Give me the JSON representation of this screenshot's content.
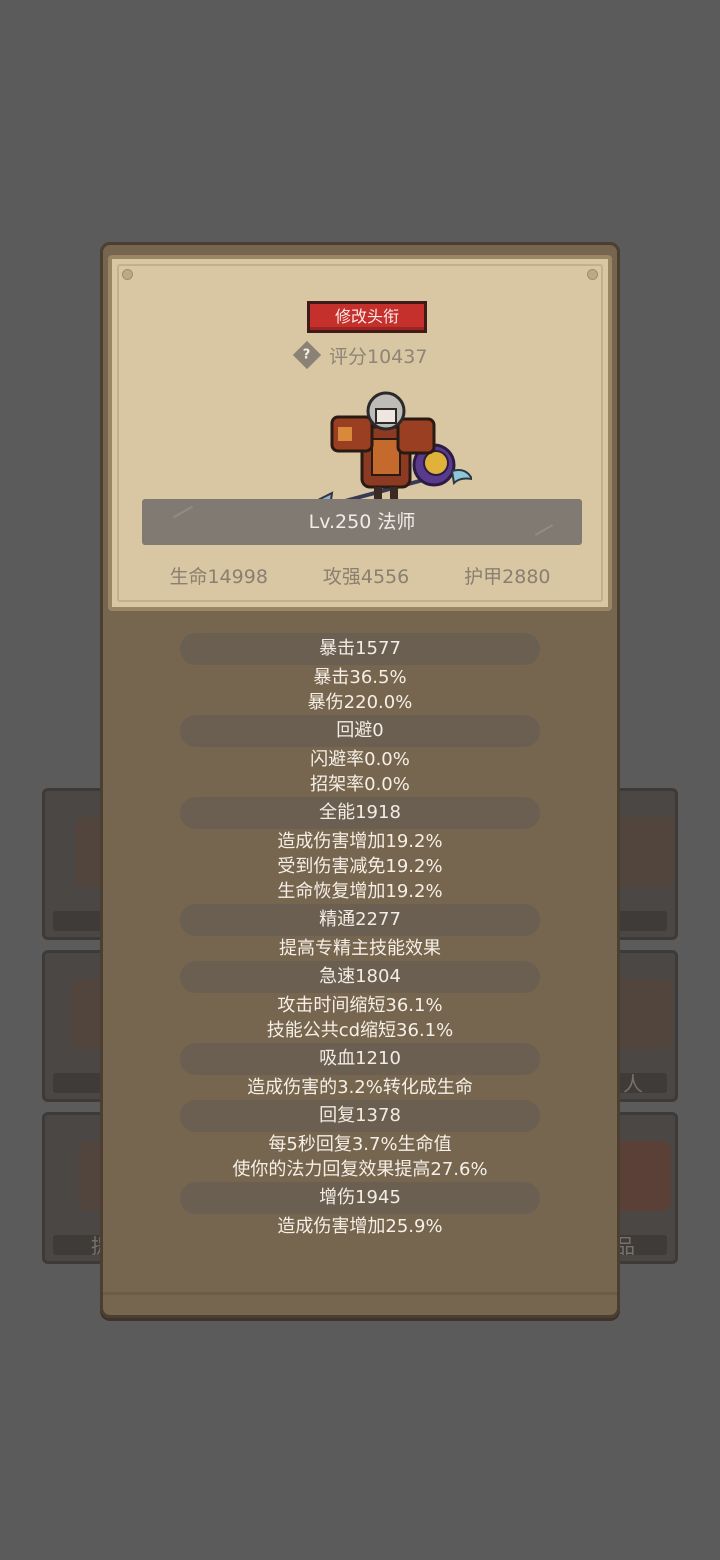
{
  "background_cards": {
    "ghost_labels": [
      "人",
      "提",
      "品"
    ]
  },
  "profile": {
    "change_title_button": "修改头衔",
    "help_icon_glyph": "?",
    "score": "评分10437",
    "level_class": "Lv.250 法师",
    "hp": "生命14998",
    "attack": "攻强4556",
    "armor": "护甲2880"
  },
  "stat_groups": [
    {
      "title": "暴击1577",
      "lines": [
        "暴击36.5%",
        "暴伤220.0%"
      ]
    },
    {
      "title": "回避0",
      "lines": [
        "闪避率0.0%",
        "招架率0.0%"
      ]
    },
    {
      "title": "全能1918",
      "lines": [
        "造成伤害增加19.2%",
        "受到伤害减免19.2%",
        "生命恢复增加19.2%"
      ]
    },
    {
      "title": "精通2277",
      "lines": [
        "提高专精主技能效果"
      ]
    },
    {
      "title": "急速1804",
      "lines": [
        "攻击时间缩短36.1%",
        "技能公共cd缩短36.1%"
      ]
    },
    {
      "title": "吸血1210",
      "lines": [
        "造成伤害的3.2%转化成生命"
      ]
    },
    {
      "title": "回复1378",
      "lines": [
        "每5秒回复3.7%生命值",
        "使你的法力回复效果提高27.6%"
      ]
    },
    {
      "title": "增伤1945",
      "lines": [
        "造成伤害增加25.9%"
      ]
    }
  ],
  "colors": {
    "title_button": "#c52f2c",
    "panel": "#76654f",
    "header_parchment": "#d9c6a3"
  }
}
